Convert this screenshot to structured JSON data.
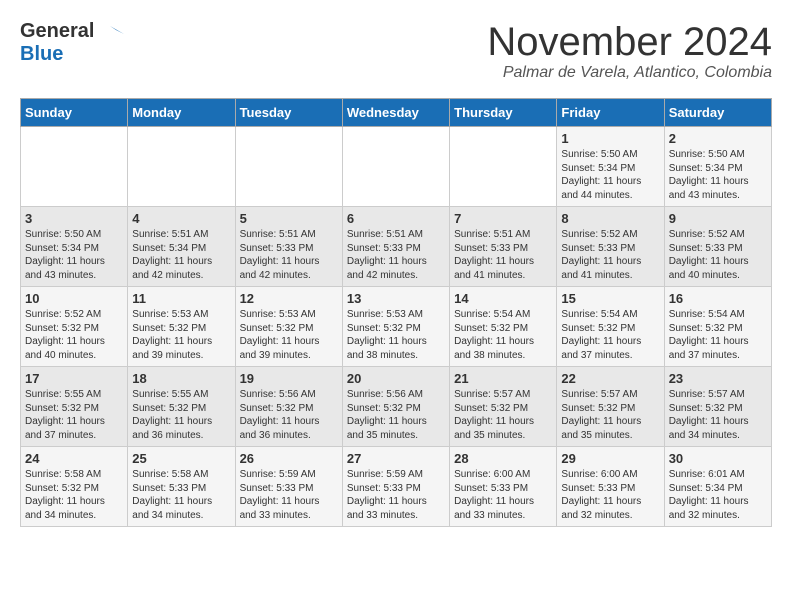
{
  "header": {
    "logo_general": "General",
    "logo_blue": "Blue",
    "month_title": "November 2024",
    "location": "Palmar de Varela, Atlantico, Colombia"
  },
  "days_of_week": [
    "Sunday",
    "Monday",
    "Tuesday",
    "Wednesday",
    "Thursday",
    "Friday",
    "Saturday"
  ],
  "weeks": [
    [
      {
        "num": "",
        "sunrise": "",
        "sunset": "",
        "daylight": ""
      },
      {
        "num": "",
        "sunrise": "",
        "sunset": "",
        "daylight": ""
      },
      {
        "num": "",
        "sunrise": "",
        "sunset": "",
        "daylight": ""
      },
      {
        "num": "",
        "sunrise": "",
        "sunset": "",
        "daylight": ""
      },
      {
        "num": "",
        "sunrise": "",
        "sunset": "",
        "daylight": ""
      },
      {
        "num": "1",
        "sunrise": "Sunrise: 5:50 AM",
        "sunset": "Sunset: 5:34 PM",
        "daylight": "Daylight: 11 hours and 44 minutes."
      },
      {
        "num": "2",
        "sunrise": "Sunrise: 5:50 AM",
        "sunset": "Sunset: 5:34 PM",
        "daylight": "Daylight: 11 hours and 43 minutes."
      }
    ],
    [
      {
        "num": "3",
        "sunrise": "Sunrise: 5:50 AM",
        "sunset": "Sunset: 5:34 PM",
        "daylight": "Daylight: 11 hours and 43 minutes."
      },
      {
        "num": "4",
        "sunrise": "Sunrise: 5:51 AM",
        "sunset": "Sunset: 5:34 PM",
        "daylight": "Daylight: 11 hours and 42 minutes."
      },
      {
        "num": "5",
        "sunrise": "Sunrise: 5:51 AM",
        "sunset": "Sunset: 5:33 PM",
        "daylight": "Daylight: 11 hours and 42 minutes."
      },
      {
        "num": "6",
        "sunrise": "Sunrise: 5:51 AM",
        "sunset": "Sunset: 5:33 PM",
        "daylight": "Daylight: 11 hours and 42 minutes."
      },
      {
        "num": "7",
        "sunrise": "Sunrise: 5:51 AM",
        "sunset": "Sunset: 5:33 PM",
        "daylight": "Daylight: 11 hours and 41 minutes."
      },
      {
        "num": "8",
        "sunrise": "Sunrise: 5:52 AM",
        "sunset": "Sunset: 5:33 PM",
        "daylight": "Daylight: 11 hours and 41 minutes."
      },
      {
        "num": "9",
        "sunrise": "Sunrise: 5:52 AM",
        "sunset": "Sunset: 5:33 PM",
        "daylight": "Daylight: 11 hours and 40 minutes."
      }
    ],
    [
      {
        "num": "10",
        "sunrise": "Sunrise: 5:52 AM",
        "sunset": "Sunset: 5:32 PM",
        "daylight": "Daylight: 11 hours and 40 minutes."
      },
      {
        "num": "11",
        "sunrise": "Sunrise: 5:53 AM",
        "sunset": "Sunset: 5:32 PM",
        "daylight": "Daylight: 11 hours and 39 minutes."
      },
      {
        "num": "12",
        "sunrise": "Sunrise: 5:53 AM",
        "sunset": "Sunset: 5:32 PM",
        "daylight": "Daylight: 11 hours and 39 minutes."
      },
      {
        "num": "13",
        "sunrise": "Sunrise: 5:53 AM",
        "sunset": "Sunset: 5:32 PM",
        "daylight": "Daylight: 11 hours and 38 minutes."
      },
      {
        "num": "14",
        "sunrise": "Sunrise: 5:54 AM",
        "sunset": "Sunset: 5:32 PM",
        "daylight": "Daylight: 11 hours and 38 minutes."
      },
      {
        "num": "15",
        "sunrise": "Sunrise: 5:54 AM",
        "sunset": "Sunset: 5:32 PM",
        "daylight": "Daylight: 11 hours and 37 minutes."
      },
      {
        "num": "16",
        "sunrise": "Sunrise: 5:54 AM",
        "sunset": "Sunset: 5:32 PM",
        "daylight": "Daylight: 11 hours and 37 minutes."
      }
    ],
    [
      {
        "num": "17",
        "sunrise": "Sunrise: 5:55 AM",
        "sunset": "Sunset: 5:32 PM",
        "daylight": "Daylight: 11 hours and 37 minutes."
      },
      {
        "num": "18",
        "sunrise": "Sunrise: 5:55 AM",
        "sunset": "Sunset: 5:32 PM",
        "daylight": "Daylight: 11 hours and 36 minutes."
      },
      {
        "num": "19",
        "sunrise": "Sunrise: 5:56 AM",
        "sunset": "Sunset: 5:32 PM",
        "daylight": "Daylight: 11 hours and 36 minutes."
      },
      {
        "num": "20",
        "sunrise": "Sunrise: 5:56 AM",
        "sunset": "Sunset: 5:32 PM",
        "daylight": "Daylight: 11 hours and 35 minutes."
      },
      {
        "num": "21",
        "sunrise": "Sunrise: 5:57 AM",
        "sunset": "Sunset: 5:32 PM",
        "daylight": "Daylight: 11 hours and 35 minutes."
      },
      {
        "num": "22",
        "sunrise": "Sunrise: 5:57 AM",
        "sunset": "Sunset: 5:32 PM",
        "daylight": "Daylight: 11 hours and 35 minutes."
      },
      {
        "num": "23",
        "sunrise": "Sunrise: 5:57 AM",
        "sunset": "Sunset: 5:32 PM",
        "daylight": "Daylight: 11 hours and 34 minutes."
      }
    ],
    [
      {
        "num": "24",
        "sunrise": "Sunrise: 5:58 AM",
        "sunset": "Sunset: 5:32 PM",
        "daylight": "Daylight: 11 hours and 34 minutes."
      },
      {
        "num": "25",
        "sunrise": "Sunrise: 5:58 AM",
        "sunset": "Sunset: 5:33 PM",
        "daylight": "Daylight: 11 hours and 34 minutes."
      },
      {
        "num": "26",
        "sunrise": "Sunrise: 5:59 AM",
        "sunset": "Sunset: 5:33 PM",
        "daylight": "Daylight: 11 hours and 33 minutes."
      },
      {
        "num": "27",
        "sunrise": "Sunrise: 5:59 AM",
        "sunset": "Sunset: 5:33 PM",
        "daylight": "Daylight: 11 hours and 33 minutes."
      },
      {
        "num": "28",
        "sunrise": "Sunrise: 6:00 AM",
        "sunset": "Sunset: 5:33 PM",
        "daylight": "Daylight: 11 hours and 33 minutes."
      },
      {
        "num": "29",
        "sunrise": "Sunrise: 6:00 AM",
        "sunset": "Sunset: 5:33 PM",
        "daylight": "Daylight: 11 hours and 32 minutes."
      },
      {
        "num": "30",
        "sunrise": "Sunrise: 6:01 AM",
        "sunset": "Sunset: 5:34 PM",
        "daylight": "Daylight: 11 hours and 32 minutes."
      }
    ]
  ]
}
